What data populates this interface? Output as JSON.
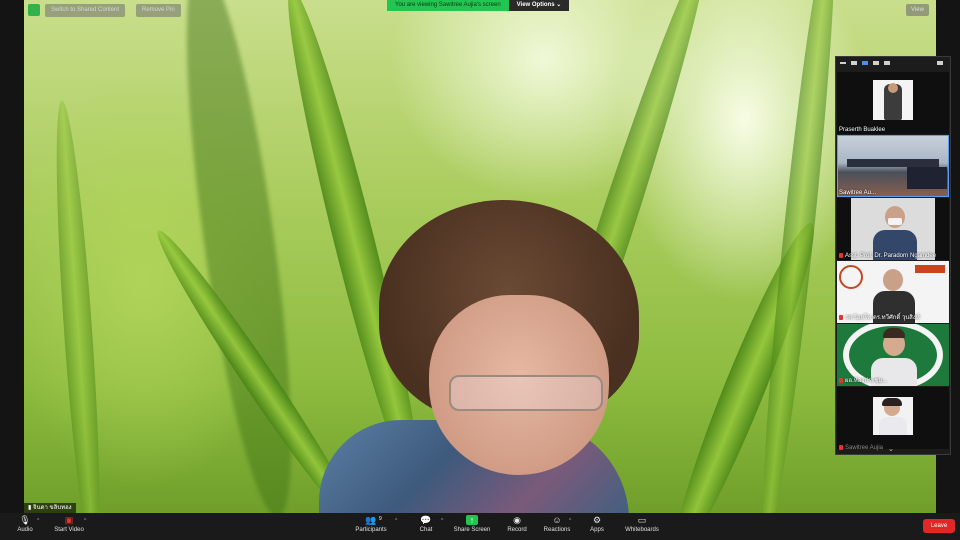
{
  "banner": {
    "switch_label": "Switch to Shared Content",
    "remove_pin_label": "Remove Pin",
    "viewing_text": "You are viewing Sawitree Aujia's screen",
    "view_options_label": "View Options",
    "view_label": "View"
  },
  "main_video": {
    "name_label": "จินดา ขลิบทอง"
  },
  "gallery": {
    "tiles": [
      {
        "name": "Praserth Buaklee",
        "muted": false
      },
      {
        "name": "Sawitree Au...",
        "muted": false
      },
      {
        "name": "Asst. Prof. Dr. Paradorn Ngamdee",
        "muted": true
      },
      {
        "name": "รศ.ร้อยโท ดร.ทวีศักดิ์ วุบสิงห์",
        "muted": true
      },
      {
        "name": "ผอ.ห้องประชุม...",
        "muted": true
      },
      {
        "name": "",
        "muted": false
      },
      {
        "name": "Sawitree Aujia",
        "muted": true
      }
    ],
    "more_icon": "chevron-down-icon"
  },
  "toolbar": {
    "audio_label": "Audio",
    "video_label": "Start Video",
    "participants_label": "Participants",
    "participants_count": "9",
    "chat_label": "Chat",
    "share_label": "Share Screen",
    "record_label": "Record",
    "reactions_label": "Reactions",
    "apps_label": "Apps",
    "whiteboards_label": "Whiteboards",
    "leave_label": "Leave"
  },
  "colors": {
    "share_green": "#23c552",
    "leave_red": "#e02828",
    "toolbar_bg": "#1a1a1a"
  }
}
